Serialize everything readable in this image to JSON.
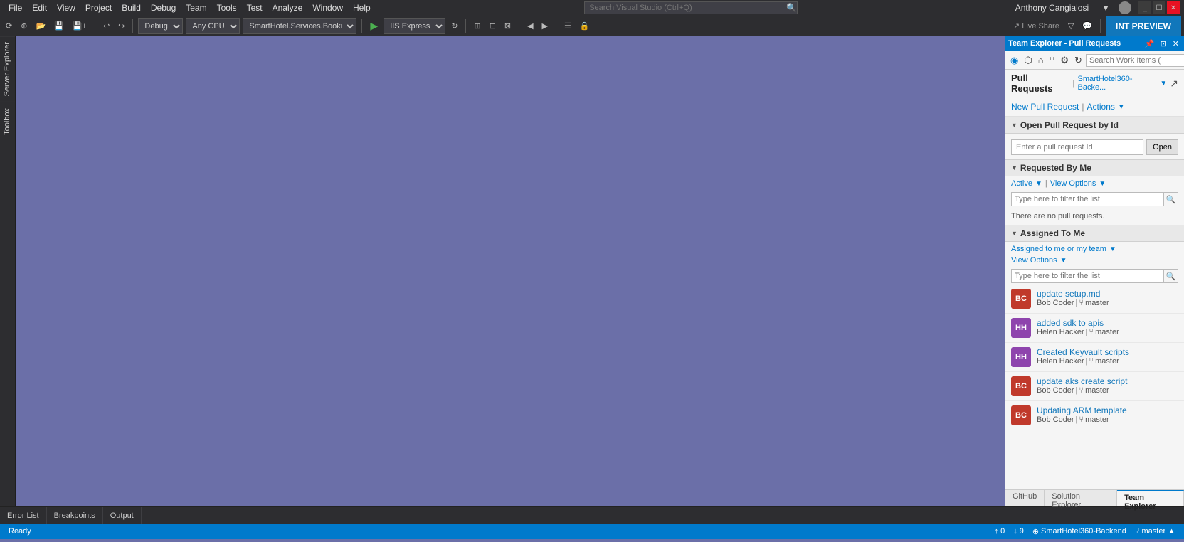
{
  "menubar": {
    "items": [
      "File",
      "Edit",
      "View",
      "Project",
      "Build",
      "Debug",
      "Team",
      "Tools",
      "Test",
      "Analyze",
      "Window",
      "Help"
    ],
    "search_placeholder": "Search Visual Studio (Ctrl+Q)",
    "user_name": "Anthony Cangialosi",
    "window_controls": [
      "_",
      "☐",
      "✕"
    ]
  },
  "toolbar": {
    "debug_config": "Debug",
    "cpu_config": "Any CPU",
    "project_config": "SmartHotel.Services.Bookings",
    "iis_config": "IIS Express",
    "int_preview_label": "INT PREVIEW",
    "live_share_label": "Live Share"
  },
  "left_sidebar": {
    "tabs": [
      "Server Explorer",
      "Toolbox"
    ]
  },
  "team_explorer": {
    "title": "Team Explorer - Pull Requests",
    "search_placeholder": "Search Work Items (",
    "panel_title": "Pull Requests",
    "repo_name": "SmartHotel360-Backe...",
    "new_pr_label": "New Pull Request",
    "actions_label": "Actions",
    "open_pr_section": {
      "title": "Open Pull Request by Id",
      "input_placeholder": "Enter a pull request Id",
      "open_btn": "Open"
    },
    "requested_by_me": {
      "title": "Requested By Me",
      "active_label": "Active",
      "view_options_label": "View Options",
      "filter_placeholder": "Type here to filter the list",
      "no_pr_msg": "There are no pull requests."
    },
    "assigned_to_me": {
      "title": "Assigned To Me",
      "assigned_filter_label": "Assigned to me or my team",
      "view_options_label": "View Options",
      "filter_placeholder": "Type here to filter the list",
      "items": [
        {
          "initials": "BC",
          "avatar_color": "#c0392b",
          "title": "update setup.md",
          "author": "Bob Coder",
          "branch": "master"
        },
        {
          "initials": "HH",
          "avatar_color": "#8e44ad",
          "title": "added sdk to apis",
          "author": "Helen Hacker",
          "branch": "master"
        },
        {
          "initials": "HH",
          "avatar_color": "#8e44ad",
          "title": "Created Keyvault scripts",
          "author": "Helen Hacker",
          "branch": "master"
        },
        {
          "initials": "BC",
          "avatar_color": "#c0392b",
          "title": "update aks create script",
          "author": "Bob Coder",
          "branch": "master"
        },
        {
          "initials": "BC",
          "avatar_color": "#c0392b",
          "title": "Updating ARM template",
          "author": "Bob Coder",
          "branch": "master"
        }
      ]
    },
    "bottom_tabs": [
      "GitHub",
      "Solution Explorer",
      "Team Explorer"
    ]
  },
  "bottom_tabs": [
    {
      "label": "Error List",
      "active": false
    },
    {
      "label": "Breakpoints",
      "active": false
    },
    {
      "label": "Output",
      "active": false
    }
  ],
  "status_bar": {
    "ready": "Ready",
    "up_count": "0",
    "down_count": "9",
    "repo": "SmartHotel360-Backend",
    "branch": "master"
  },
  "icons": {
    "search": "🔍",
    "back": "◀",
    "forward": "▶",
    "home": "⌂",
    "connect": "⬡",
    "refresh": "↻",
    "undo": "↩",
    "redo": "↪",
    "run": "▶",
    "branch": "⑂",
    "arrow_down": "▼",
    "arrow_up": "▲",
    "triangle": "▶",
    "pin": "📌",
    "close": "✕",
    "collapse": "◀",
    "expand": "↗"
  }
}
